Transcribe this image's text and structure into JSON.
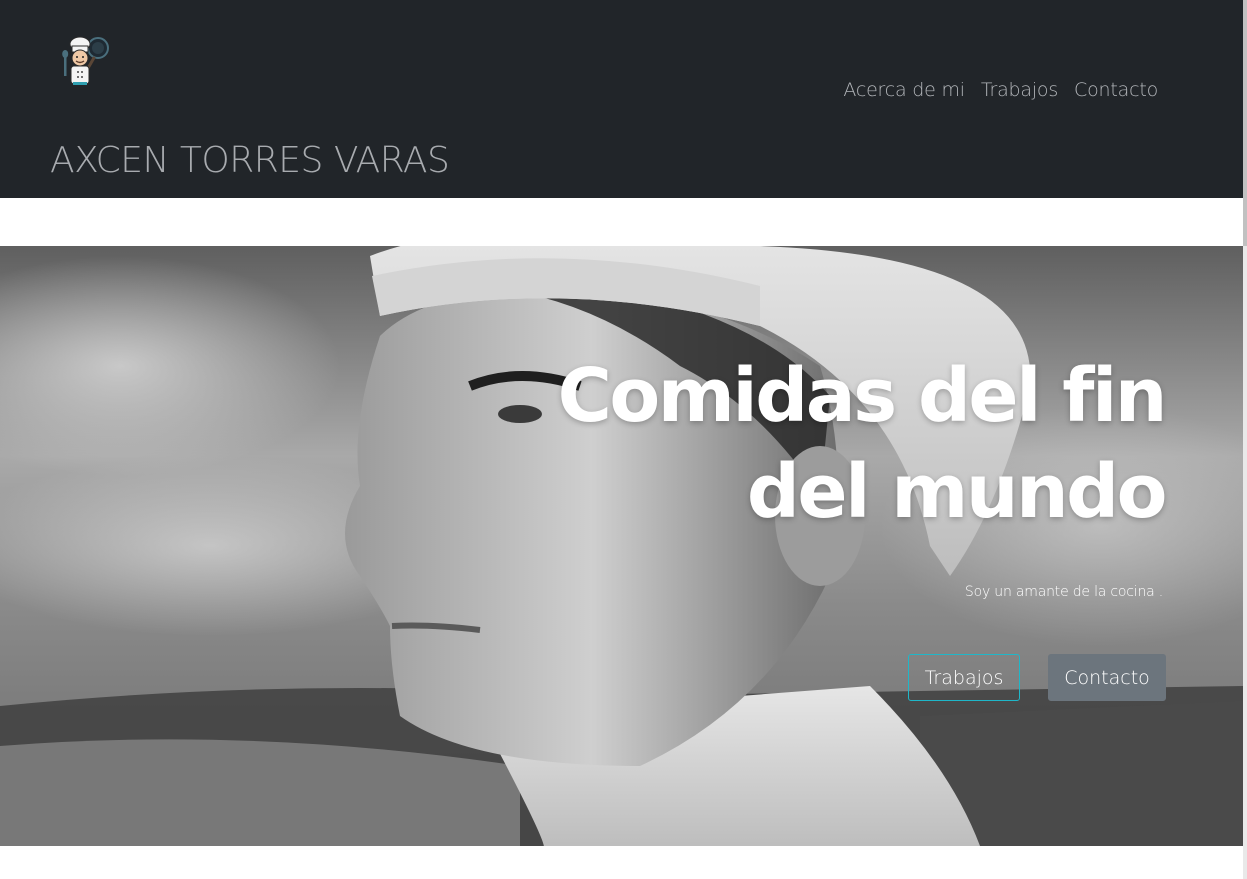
{
  "header": {
    "brand_name": "AXCEN TORRES VARAS",
    "logo_icon": "chef-logo-icon",
    "nav": [
      {
        "label": "Acerca de mi"
      },
      {
        "label": "Trabajos"
      },
      {
        "label": "Contacto"
      }
    ]
  },
  "hero": {
    "title_line1": "Comidas del fin",
    "title_line2": "del mundo",
    "subtitle": "Soy un amante de la cocina .",
    "buttons": {
      "works_label": "Trabajos",
      "contact_label": "Contacto"
    },
    "image_icon": "chef-portrait-image"
  },
  "colors": {
    "header_bg": "#212529",
    "nav_text": "#b3b6ba",
    "accent_outline": "#1fb7c9",
    "secondary_button": "#6c757d"
  }
}
